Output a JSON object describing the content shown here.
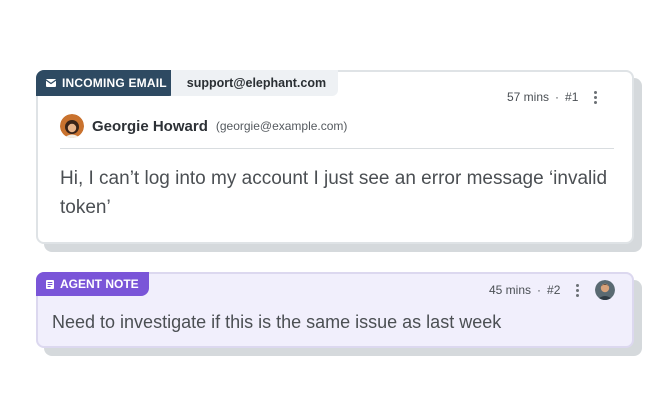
{
  "email_card": {
    "badge_label": "INCOMING EMAIL",
    "mailbox": "support@elephant.com",
    "time": "57 mins",
    "separator": "·",
    "number": "#1",
    "sender_name": "Georgie Howard",
    "sender_email": "(georgie@example.com)",
    "body": "Hi, I can’t log into my account I just see an error message ‘invalid token’"
  },
  "note_card": {
    "badge_label": "AGENT NOTE",
    "time": "45 mins",
    "separator": "·",
    "number": "#2",
    "body": "Need to investigate if this is the same issue as last week"
  },
  "colors": {
    "email_badge": "#2e4a62",
    "note_badge": "#7a55d8",
    "note_background": "#f1effc"
  },
  "icons": [
    "mail-icon",
    "note-icon",
    "kebab-menu-icon",
    "avatar"
  ]
}
